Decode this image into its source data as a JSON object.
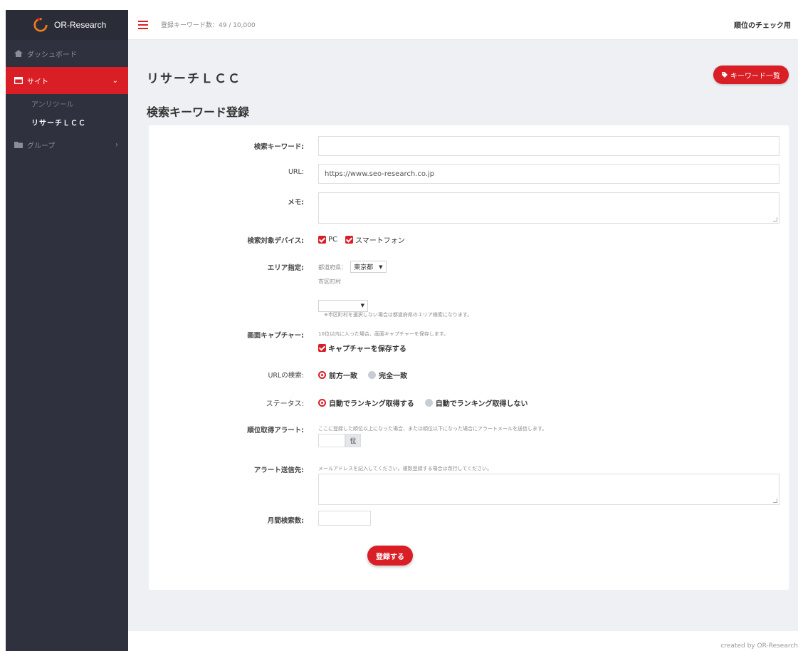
{
  "brand": {
    "name": "OR-Research"
  },
  "topbar": {
    "keyword_count": "登録キーワード数：49 / 10,000",
    "right_label": "順位のチェック用"
  },
  "sidebar": {
    "items": [
      {
        "label": "ダッシュボード"
      },
      {
        "label": "サイト"
      },
      {
        "label": "グループ"
      }
    ],
    "sub_items": [
      {
        "label": "アンリツール"
      },
      {
        "label": "リサーチＬＣＣ"
      }
    ]
  },
  "page": {
    "title": "リサーチＬＣＣ",
    "keyword_list_button": "キーワード一覧",
    "section_title": "検索キーワード登録"
  },
  "form": {
    "keyword": {
      "label": "検索キーワード:",
      "value": ""
    },
    "url": {
      "label": "URL:",
      "value": "https://www.seo-research.co.jp"
    },
    "memo": {
      "label": "メモ:",
      "value": ""
    },
    "device": {
      "label": "検索対象デバイス:",
      "options": [
        "PC",
        "スマートフォン"
      ]
    },
    "area": {
      "label": "エリア指定:",
      "prefecture_label": "都道府県：",
      "prefecture_value": "東京都",
      "city_label": "市区町村",
      "city_value": "",
      "note": "※市区町村を選択しない場合は都道府県のエリア検索になります。"
    },
    "capture": {
      "label": "画面キャプチャー:",
      "note": "10位以内に入った場合、画面キャプチャーを保存します。",
      "checkbox_label": "キャプチャーを保存する"
    },
    "url_match": {
      "label": "URLの検索:",
      "options": [
        "前方一致",
        "完全一致"
      ]
    },
    "status": {
      "label": "ステータス:",
      "options": [
        "自動でランキング取得する",
        "自動でランキング取得しない"
      ]
    },
    "rank_alert": {
      "label": "順位取得アラート:",
      "note": "ここに登録した順位以上になった場合、または順位以下になった場合にアラートメールを送信します。",
      "value": "",
      "unit": "位"
    },
    "alert_to": {
      "label": "アラート送信先:",
      "note": "メールアドレスを記入してください。複数登録する場合は改行してください。",
      "value": ""
    },
    "monthly_searches": {
      "label": "月間検索数:",
      "value": ""
    },
    "submit_label": "登録する"
  },
  "footer": {
    "text": "created by OR-Research"
  },
  "colors": {
    "accent": "#d91e26",
    "sidebar": "#2f323e",
    "background": "#eef0f3"
  }
}
